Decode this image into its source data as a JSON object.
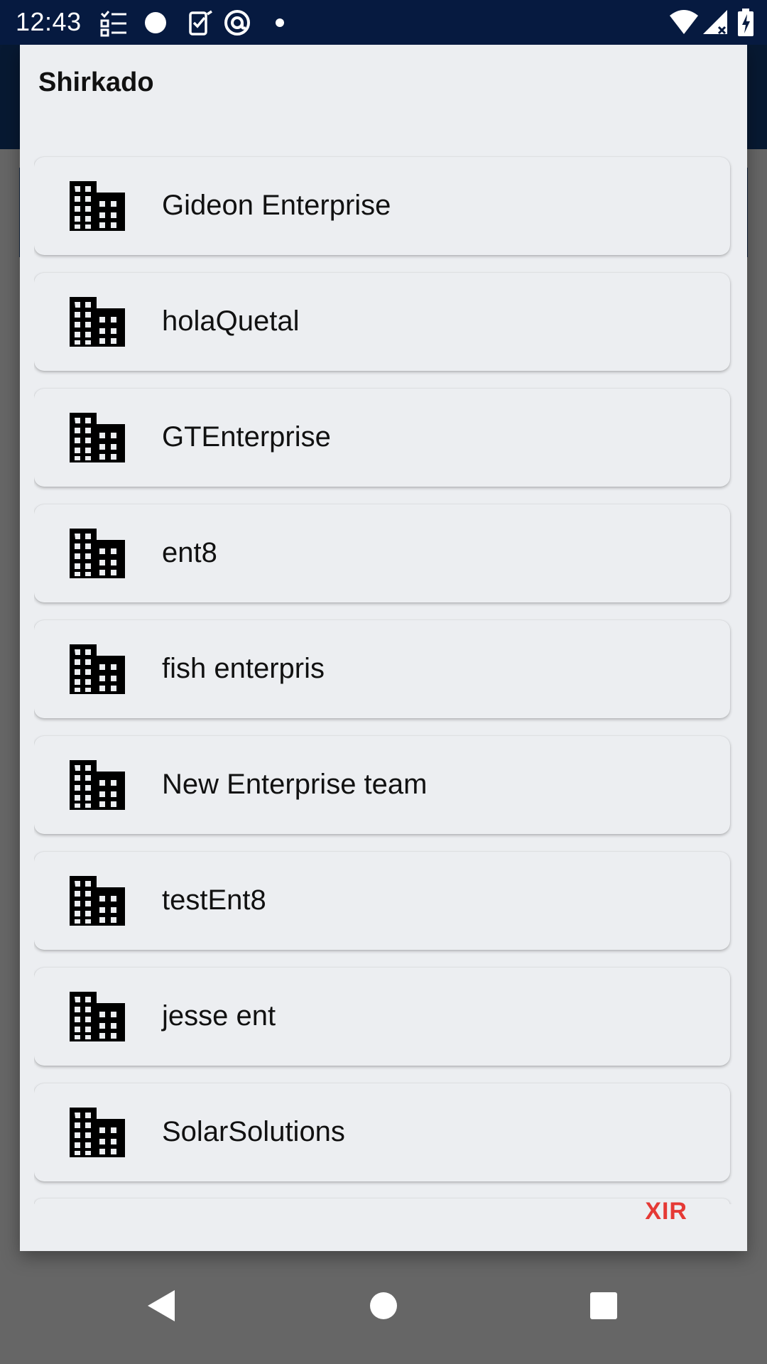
{
  "status_bar": {
    "time": "12:43",
    "icons": [
      "checklist-icon",
      "circle-icon",
      "clipboard-check-icon",
      "at-sign-icon",
      "dot-icon",
      "wifi-icon",
      "signal-icon",
      "battery-charging-icon"
    ]
  },
  "dialog": {
    "title": "Shirkado",
    "items": [
      {
        "label": "Gideon Enterprise",
        "icon": "building-icon"
      },
      {
        "label": "holaQuetal",
        "icon": "building-icon"
      },
      {
        "label": "GTEnterprise",
        "icon": "building-icon"
      },
      {
        "label": "ent8",
        "icon": "building-icon"
      },
      {
        "label": "fish enterpris",
        "icon": "building-icon"
      },
      {
        "label": "New Enterprise team",
        "icon": "building-icon"
      },
      {
        "label": "testEnt8",
        "icon": "building-icon"
      },
      {
        "label": "jesse ent",
        "icon": "building-icon"
      },
      {
        "label": "SolarSolutions",
        "icon": "building-icon"
      }
    ],
    "close_label": "XIR"
  },
  "nav_bar": {
    "buttons": [
      "back-icon",
      "home-icon",
      "recents-icon"
    ]
  },
  "colors": {
    "status_bar": "#061a40",
    "app_primary": "#113a73",
    "dialog_bg": "#eceef1",
    "close_text": "#e53935"
  }
}
